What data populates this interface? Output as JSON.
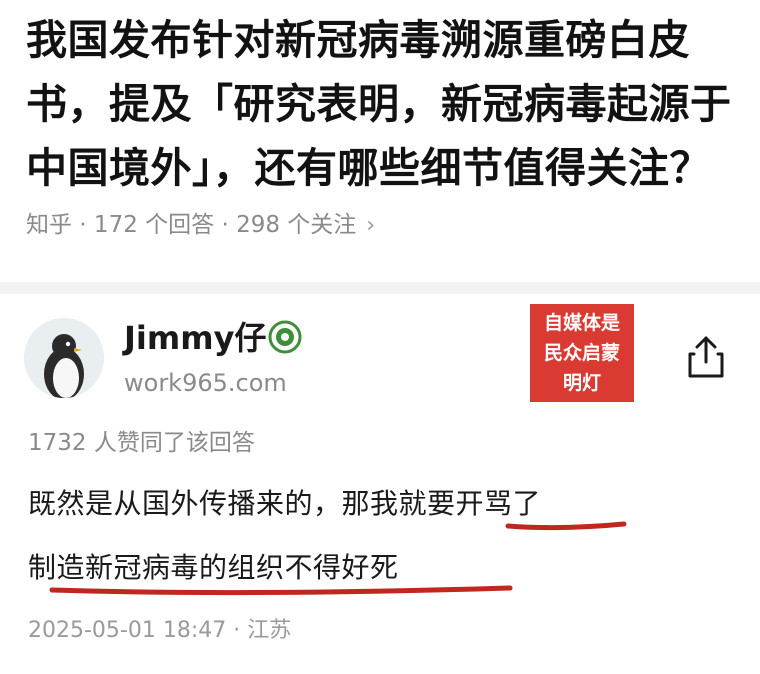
{
  "question": {
    "title": "我国发布针对新冠病毒溯源重磅白皮书，提及「研究表明，新冠病毒起源于中国境外」，还有哪些细节值得关注？",
    "meta": "知乎 · 172 个回答 · 298 个关注",
    "chevron": "›"
  },
  "answer": {
    "author_name": "Jimmy仔",
    "author_site": "work965.com",
    "stamp_lines": [
      "自媒体是",
      "民众启蒙",
      "明灯"
    ],
    "vote_text": "1732 人赞同了该回答",
    "line1": "既然是从国外传播来的，那我就要开骂了",
    "line2": "制造新冠病毒的组织不得好死",
    "timestamp": "2025-05-01 18:47 · 江苏"
  },
  "colors": {
    "accent_red": "#d93a32",
    "underline_red": "#c0281f",
    "badge_green": "#3f8f3a"
  },
  "icons": {
    "avatar": "penguin-avatar",
    "badge": "verified-badge-icon",
    "share": "share-icon"
  }
}
